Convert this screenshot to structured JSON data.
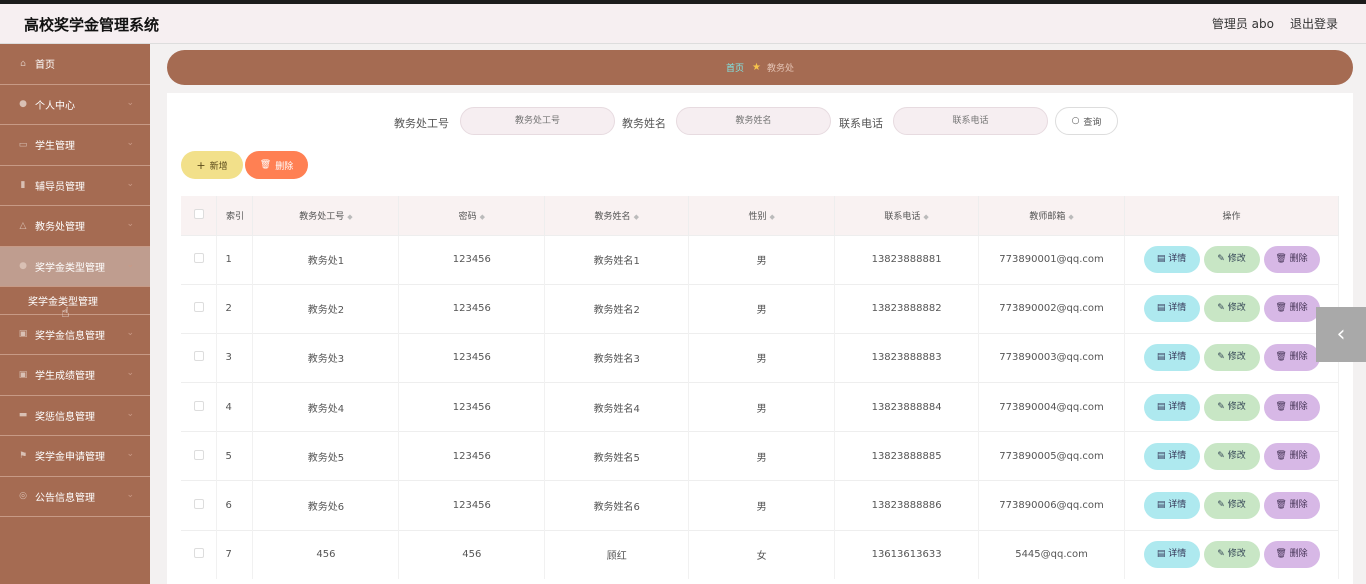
{
  "header": {
    "title": "高校奖学金管理系统",
    "admin": "管理员 abo",
    "logout": "退出登录"
  },
  "sidebar": {
    "items": [
      {
        "label": "首页",
        "icon": "home-icon",
        "chevron": false
      },
      {
        "label": "个人中心",
        "icon": "user-icon",
        "chevron": true
      },
      {
        "label": "学生管理",
        "icon": "chat-icon",
        "chevron": true
      },
      {
        "label": "辅导员管理",
        "icon": "badge-icon",
        "chevron": true
      },
      {
        "label": "教务处管理",
        "icon": "warning-icon",
        "chevron": true
      },
      {
        "label": "奖学金类型管理",
        "icon": "user-icon",
        "chevron": true,
        "active": true
      },
      {
        "label": "奖学金信息管理",
        "icon": "clipboard-icon",
        "chevron": true
      },
      {
        "label": "学生成绩管理",
        "icon": "clipboard-icon",
        "chevron": true
      },
      {
        "label": "奖惩信息管理",
        "icon": "box-icon",
        "chevron": true
      },
      {
        "label": "奖学金申请管理",
        "icon": "flag-icon",
        "chevron": true
      },
      {
        "label": "公告信息管理",
        "icon": "globe-icon",
        "chevron": true
      }
    ],
    "submenu_label": "奖学金类型管理"
  },
  "breadcrumb": {
    "home": "首页",
    "current": "教务处"
  },
  "search": {
    "fields": [
      {
        "label": "教务处工号",
        "placeholder": "教务处工号"
      },
      {
        "label": "教务姓名",
        "placeholder": "教务姓名"
      },
      {
        "label": "联系电话",
        "placeholder": "联系电话"
      }
    ],
    "button": "查询"
  },
  "actions": {
    "add": "新增",
    "delete": "删除"
  },
  "table": {
    "headers": [
      "索引",
      "教务处工号",
      "密码",
      "教务姓名",
      "性别",
      "联系电话",
      "教师邮箱",
      "操作"
    ],
    "rows": [
      [
        "1",
        "教务处1",
        "123456",
        "教务姓名1",
        "男",
        "13823888881",
        "773890001@qq.com"
      ],
      [
        "2",
        "教务处2",
        "123456",
        "教务姓名2",
        "男",
        "13823888882",
        "773890002@qq.com"
      ],
      [
        "3",
        "教务处3",
        "123456",
        "教务姓名3",
        "男",
        "13823888883",
        "773890003@qq.com"
      ],
      [
        "4",
        "教务处4",
        "123456",
        "教务姓名4",
        "男",
        "13823888884",
        "773890004@qq.com"
      ],
      [
        "5",
        "教务处5",
        "123456",
        "教务姓名5",
        "男",
        "13823888885",
        "773890005@qq.com"
      ],
      [
        "6",
        "教务处6",
        "123456",
        "教务姓名6",
        "男",
        "13823888886",
        "773890006@qq.com"
      ],
      [
        "7",
        "456",
        "456",
        "顾红",
        "女",
        "13613613633",
        "5445@qq.com"
      ]
    ],
    "row_actions": {
      "detail": "详情",
      "edit": "修改",
      "delete": "删除"
    }
  },
  "colors": {
    "brand": "#a56b52",
    "crumb_home": "#7fe6e6"
  }
}
